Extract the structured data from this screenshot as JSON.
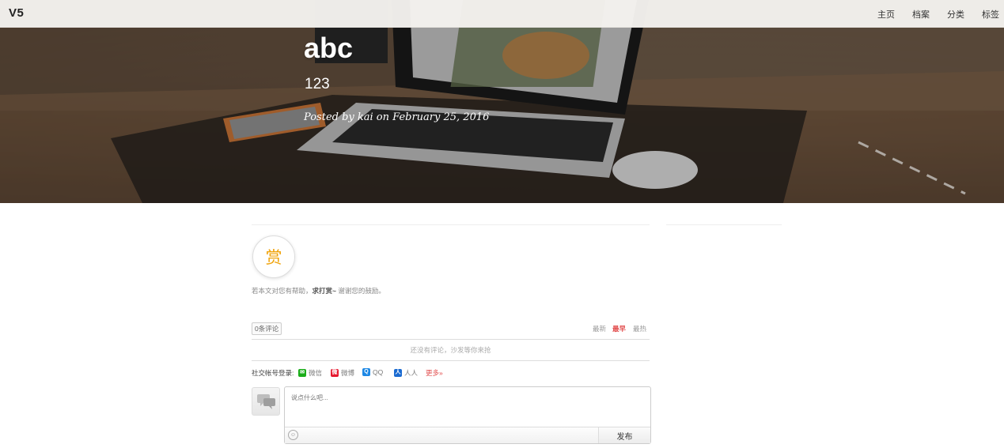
{
  "navbar": {
    "brand": "V5",
    "links": [
      "主页",
      "档案",
      "分类",
      "标签"
    ]
  },
  "post": {
    "title": "abc",
    "subtitle": "123",
    "meta": "Posted by kai on February 25, 2016"
  },
  "reward": {
    "button_label": "赏",
    "text_before": "若本文对您有帮助，",
    "text_bold": "求打赏~",
    "text_after": " 谢谢您的鼓励。"
  },
  "comments": {
    "count_label": "0条评论",
    "sort": [
      "最新",
      "最早",
      "最热"
    ],
    "active_sort": "最早",
    "empty_message": "还没有评论，沙发等你来抢",
    "social_label": "社交帐号登录:",
    "social": [
      {
        "name": "微信",
        "icon": "wechat-icon",
        "color": "#1aad19"
      },
      {
        "name": "微博",
        "icon": "weibo-icon",
        "color": "#e6162d"
      },
      {
        "name": "QQ",
        "icon": "qq-icon",
        "color": "#1e88e5"
      },
      {
        "name": "人人",
        "icon": "renren-icon",
        "color": "#1b6bd1"
      }
    ],
    "more_label": "更多»",
    "input_placeholder": "说点什么吧...",
    "post_button": "发布"
  },
  "colors": {
    "accent_red": "#e24d4d",
    "reward_gold": "#f0a30a"
  }
}
